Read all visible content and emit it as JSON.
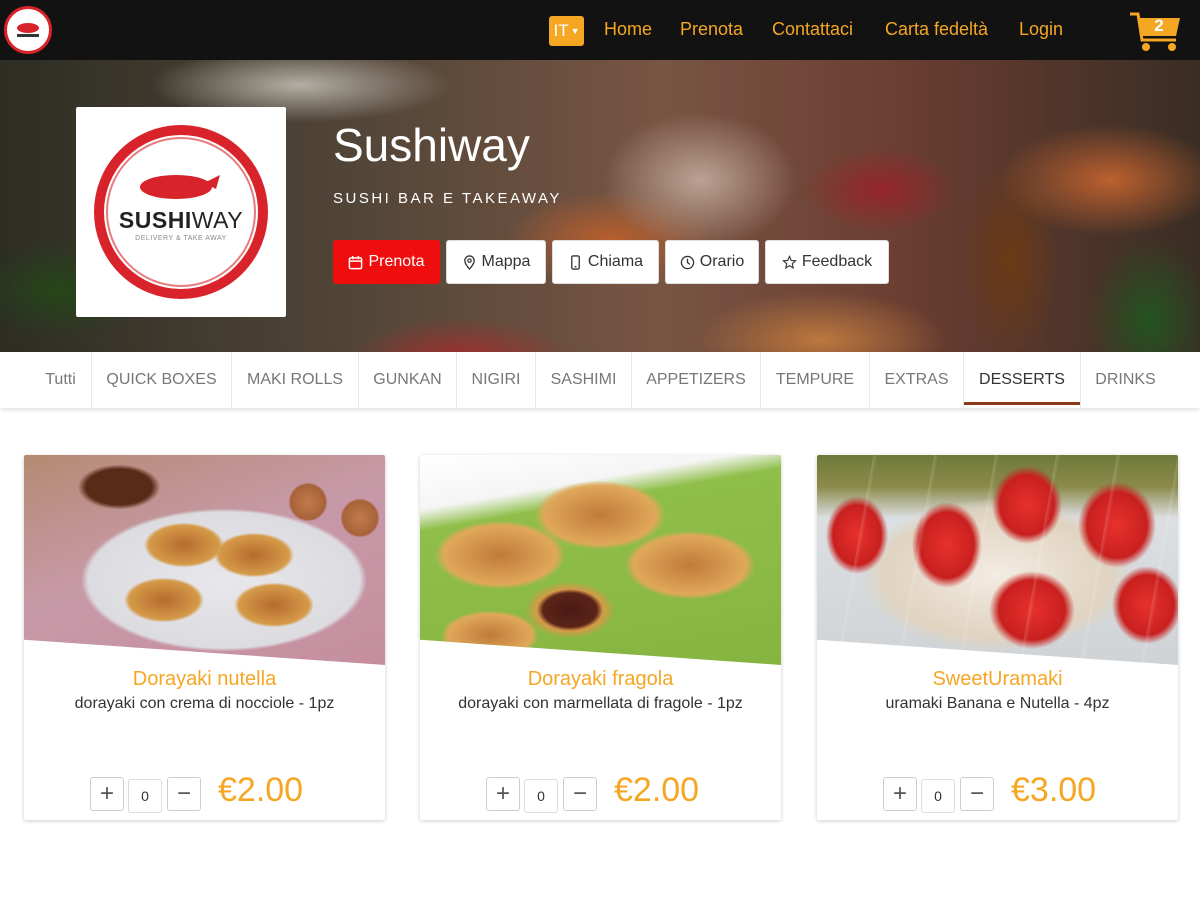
{
  "header": {
    "language": "IT",
    "nav": [
      "Home",
      "Prenota",
      "Contattaci",
      "Carta fedeltà",
      "Login"
    ],
    "cart_count": "2"
  },
  "hero": {
    "title": "Sushiway",
    "subtitle": "SUSHI BAR E TAKEAWAY",
    "logo_brand_bold": "SUSHI",
    "logo_brand_light": "WAY",
    "logo_tagline": "DELIVERY & TAKE AWAY",
    "buttons": [
      {
        "label": "Prenota",
        "icon": "calendar-icon"
      },
      {
        "label": "Mappa",
        "icon": "map-pin-icon"
      },
      {
        "label": "Chiama",
        "icon": "phone-icon"
      },
      {
        "label": "Orario",
        "icon": "clock-icon"
      },
      {
        "label": "Feedback",
        "icon": "star-icon"
      }
    ]
  },
  "categories": {
    "items": [
      "Tutti",
      "QUICK BOXES",
      "MAKI ROLLS",
      "GUNKAN",
      "NIGIRI",
      "SASHIMI",
      "APPETIZERS",
      "TEMPURE",
      "EXTRAS",
      "DESSERTS",
      "DRINKS"
    ],
    "active": "DESSERTS"
  },
  "products": [
    {
      "name": "Dorayaki nutella",
      "description": "dorayaki con crema di nocciole - 1pz",
      "quantity": "0",
      "price": "€2.00"
    },
    {
      "name": "Dorayaki fragola",
      "description": "dorayaki con marmellata di fragole - 1pz",
      "quantity": "0",
      "price": "€2.00"
    },
    {
      "name": "SweetUramaki",
      "description": "uramaki Banana e Nutella - 4pz",
      "quantity": "0",
      "price": "€3.00"
    }
  ],
  "colors": {
    "accent": "#f5a623",
    "brand_red": "#f00d0d",
    "topbar": "#121212",
    "active_tab_underline": "#8b3a1a"
  }
}
